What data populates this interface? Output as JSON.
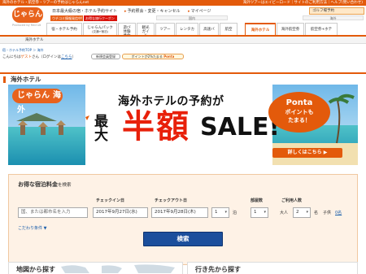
{
  "topbar": {
    "left_text": "海外のホテル・航空券・ツアーの予約はじゃらんnet",
    "right_text": "海外ツアーはエイビーロード｜サイトのご利用方法｜ヘルプ(問い合わせ)"
  },
  "header": {
    "logo_text": "じゃらん",
    "logo_sub": "Produced by Recruit",
    "tagline": "日本最大級の宿・ホテル予約サイト",
    "links": [
      "予約照会・変更・キャンセル",
      "マイページ"
    ],
    "golf_label": "ゴルフ場予約",
    "campaign_left": "ウチコミ情報発信中!",
    "campaign_right": "お得な旅行クーポン配布中"
  },
  "nav": {
    "domestic_label": "国内",
    "overseas_label": "海外",
    "items": [
      {
        "label": "宿・ホテル予約"
      },
      {
        "label": "じゃらんパック",
        "sub": "(交通+宿泊)"
      },
      {
        "label": "遊び",
        "sub": "体験予約"
      },
      {
        "label": "観光",
        "sub": "ガイド"
      },
      {
        "label": "ツアー"
      },
      {
        "label": "レンタカー"
      },
      {
        "label": "高速バス"
      },
      {
        "label": "航空券"
      }
    ],
    "overseas_items": [
      {
        "label": "海外ホテル"
      },
      {
        "label": "海外航空券"
      },
      {
        "label": "航空券+ホテル"
      }
    ]
  },
  "subnav": {
    "active_tab": "海外ホテル"
  },
  "breadcrumb": "宿・ホテル予約TOP ＞ 海外",
  "greeting": {
    "prefix": "こんにちは",
    "guest": "ゲスト",
    "suffix": "さん（ログインは",
    "login": "こちら",
    "close": "）"
  },
  "pills": {
    "register": "新規会員登録",
    "points_pre": "ポイントが2%たまる",
    "points_brand": "Ponta"
  },
  "section_title": "海外ホテル",
  "banner": {
    "logo": "じゃらん",
    "logo_sub": "海外",
    "headline": "海外ホテルの予約が",
    "max": "最大",
    "half": "半額",
    "sale": "SALE!",
    "ponta_brand": "Ponta",
    "ponta_line1": "ポイントも",
    "ponta_line2": "たまる！",
    "detail_button": "詳しくはこちら ▶"
  },
  "search": {
    "title": "お得な宿泊料金",
    "title_suffix": "を検索",
    "destination_placeholder": "国、または都市名を入力",
    "checkin_label": "チェックイン日",
    "checkin_value": "2017年9月27日(水)",
    "checkout_label": "チェックアウト日",
    "checkout_value": "2017年9月28日(木)",
    "nights_value": "1",
    "nights_unit": "泊",
    "rooms_label": "部屋数",
    "rooms_value": "1",
    "guests_label": "ご利用人数",
    "adults_prefix": "大人",
    "adults_value": "2",
    "adults_unit": "名",
    "children_prefix": "子供",
    "children_value": "0名",
    "kodawari": "こだわり条件 ▼",
    "search_button": "検索"
  },
  "bottom": {
    "left_title": "地図から探す",
    "right_title": "行き先から探す"
  },
  "colors": {
    "accent": "#e35a0b",
    "search_button": "#1b4f9c",
    "sale_red": "#e8200a"
  }
}
